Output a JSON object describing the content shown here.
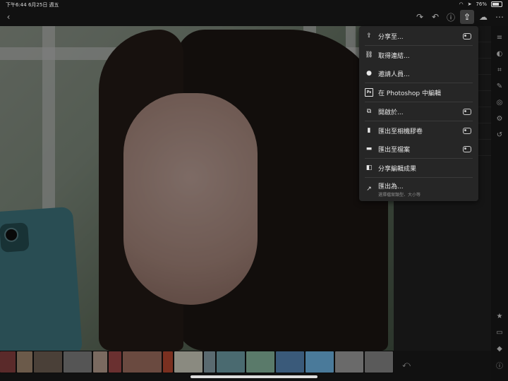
{
  "status_bar": {
    "time": "下午6:44",
    "date": "6月25日 週五",
    "battery": "76%"
  },
  "share_menu": {
    "items": [
      {
        "label": "分享至...",
        "icon": "share-icon",
        "has_settings": true
      },
      {
        "label": "取得連結...",
        "icon": "link-icon",
        "has_settings": false
      },
      {
        "label": "邀請人員...",
        "icon": "invite-person-icon",
        "has_settings": false
      },
      {
        "label": "在 Photoshop 中編輯",
        "icon": "photoshop-icon",
        "has_settings": false
      },
      {
        "label": "開啟於...",
        "icon": "open-in-icon",
        "has_settings": true
      },
      {
        "label": "匯出至相機膠卷",
        "icon": "camera-roll-icon",
        "has_settings": true
      },
      {
        "label": "匯出至檔案",
        "icon": "folder-icon",
        "has_settings": true
      },
      {
        "label": "分享編輯成果",
        "icon": "share-edits-icon",
        "has_settings": false
      },
      {
        "label": "匯出為...",
        "sublabel": "選擇檔案類型、大小等",
        "icon": "export-as-icon",
        "has_settings": false
      }
    ]
  },
  "icons": {
    "back": "back-chevron-icon",
    "redo": "redo-icon",
    "undo": "undo-icon",
    "help": "help-icon",
    "share": "share-icon",
    "cloud": "cloud-sync-icon",
    "more": "more-icon"
  },
  "colors": {
    "menu_bg": "#262626",
    "panel_bg": "#151515",
    "text": "#e8e8e8"
  }
}
